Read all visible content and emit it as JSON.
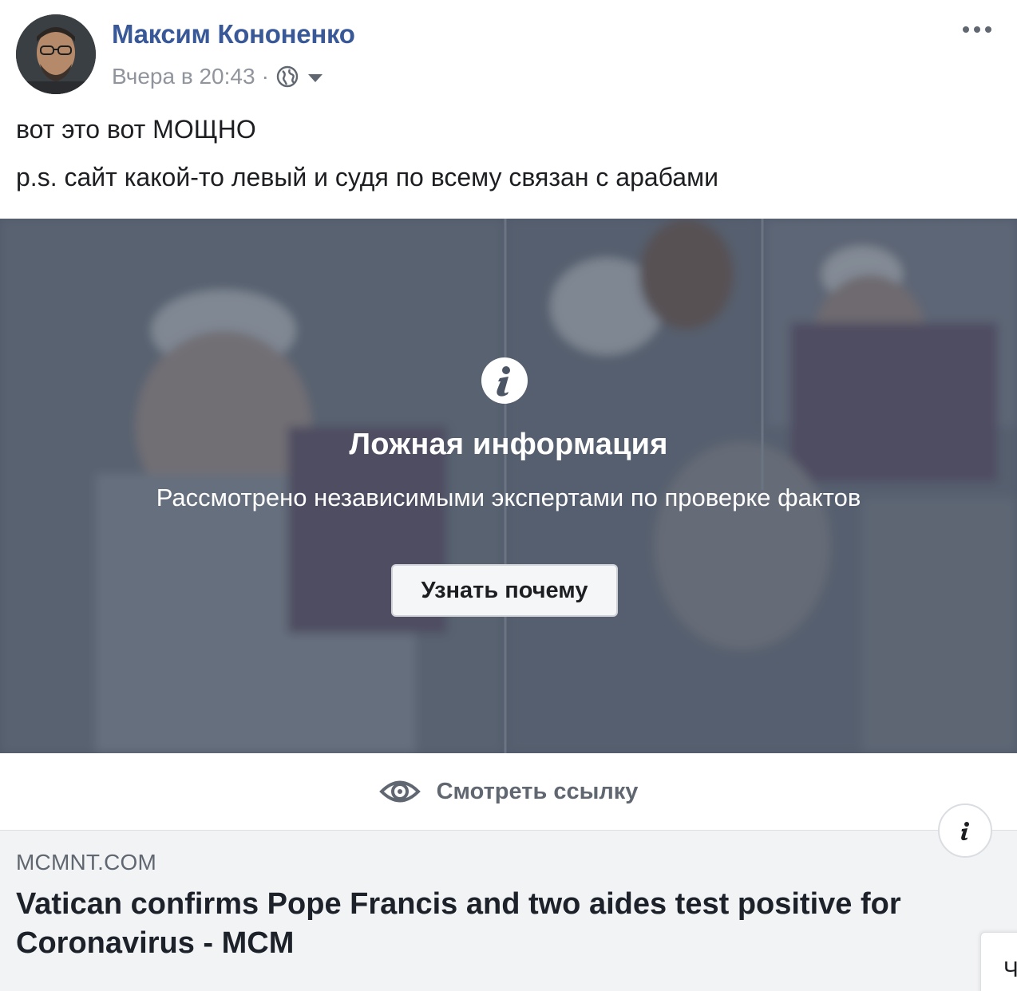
{
  "post": {
    "author_name": "Максим Кононенко",
    "timestamp": "Вчера в 20:43",
    "separator": "·",
    "privacy_icon": "globe-icon",
    "text_lines": [
      "вот это вот МОЩНО",
      "p.s. сайт какой-то левый и судя по всему связан с арабами"
    ]
  },
  "fact_check": {
    "title": "Ложная информация",
    "subtitle": "Рассмотрено независимыми экспертами по проверке фактов",
    "button_label": "Узнать почему"
  },
  "see_link": {
    "label": "Смотреть ссылку"
  },
  "link_preview": {
    "domain": "MCMNT.COM",
    "headline": "Vatican confirms Pope Francis and two aides test positive for Coronavirus - MCM"
  },
  "side_tab": {
    "label": "Ч"
  },
  "colors": {
    "author_link": "#385898",
    "meta_gray": "#90949c",
    "overlay": "#5d6676",
    "preview_bg": "#f2f3f5"
  }
}
